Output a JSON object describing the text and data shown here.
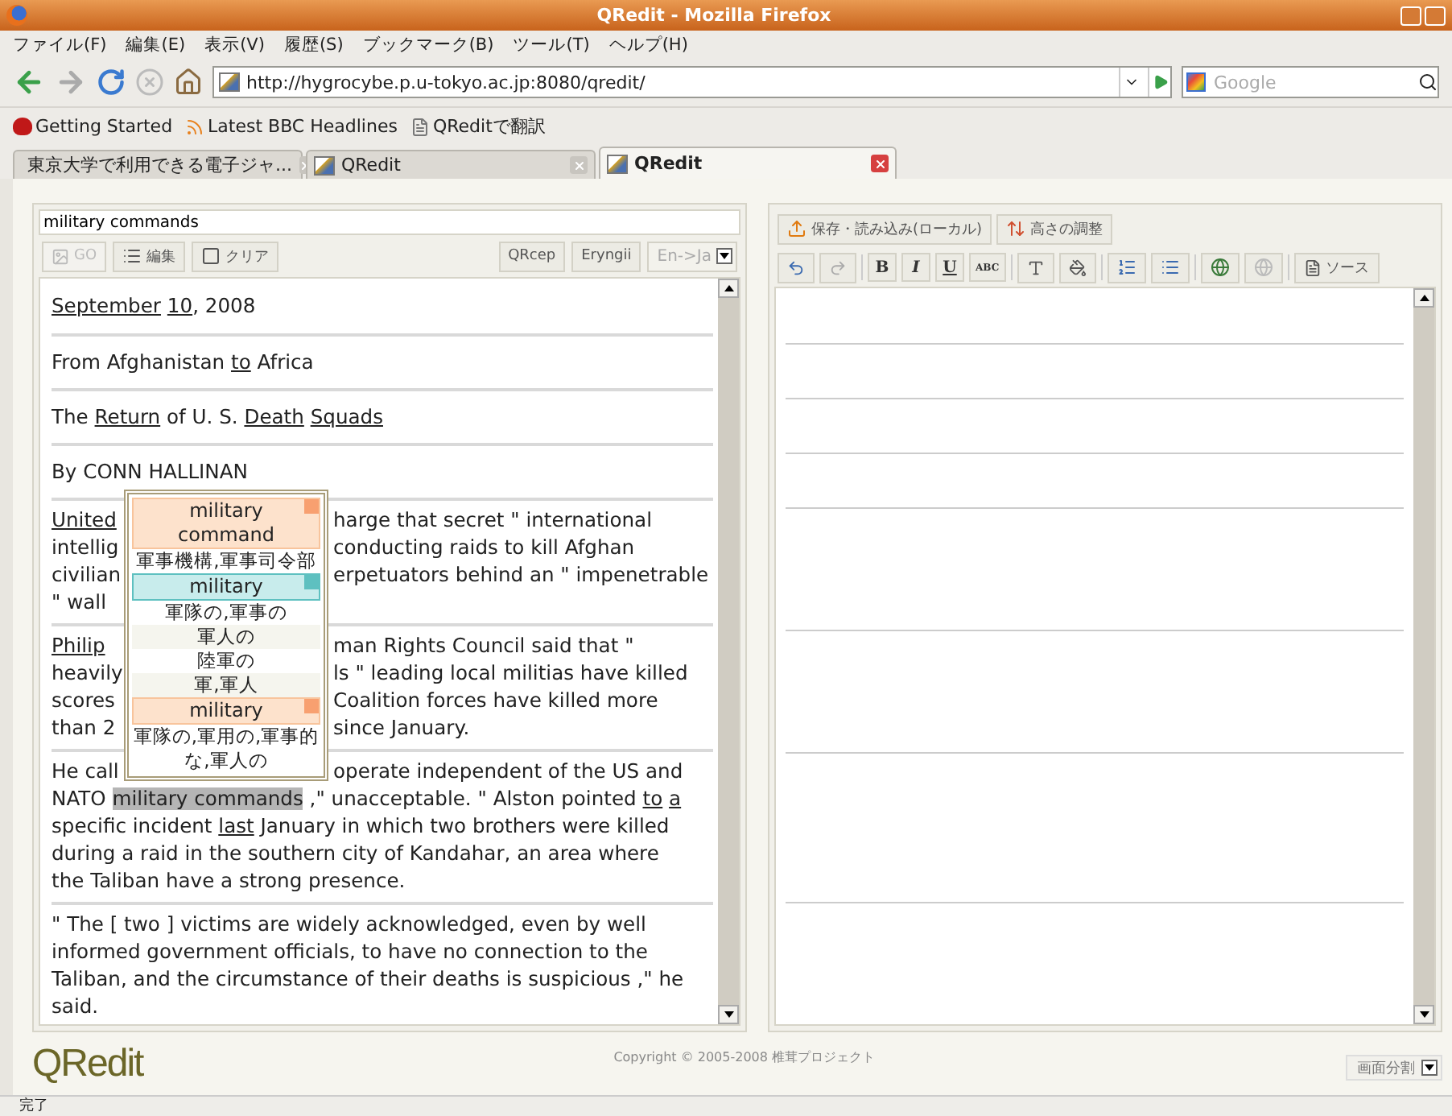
{
  "window": {
    "title": "QRedit - Mozilla Firefox"
  },
  "menu": [
    "ファイル(F)",
    "編集(E)",
    "表示(V)",
    "履歴(S)",
    "ブックマーク(B)",
    "ツール(T)",
    "ヘルプ(H)"
  ],
  "address": {
    "url": "http://hygrocybe.p.u-tokyo.ac.jp:8080/qredit/"
  },
  "web_search": {
    "placeholder": "Google"
  },
  "bookmarks": [
    {
      "kind": "start",
      "label": "Getting Started"
    },
    {
      "kind": "feed",
      "label": "Latest BBC Headlines"
    },
    {
      "kind": "page",
      "label": "QReditで翻訳"
    }
  ],
  "tabs": [
    {
      "kind": "page",
      "label": "東京大学で利用できる電子ジャ...",
      "selected": false
    },
    {
      "kind": "app",
      "label": "QRedit",
      "selected": false
    },
    {
      "kind": "app",
      "label": "QRedit",
      "selected": true
    }
  ],
  "query": {
    "value": "military commands"
  },
  "left_toolbar": {
    "buttons": [
      {
        "kind": "go",
        "label": "GO",
        "disabled": true
      },
      {
        "kind": "edit",
        "label": "編集",
        "disabled": false
      },
      {
        "kind": "clear",
        "label": "クリア",
        "disabled": false
      }
    ],
    "dictionaries": [
      "QRcep",
      "Eryngii"
    ],
    "direction": "En->Ja"
  },
  "paragraphs": [
    {
      "lines": [
        {
          "left": [
            {
              "kind": "link",
              "text": "September "
            },
            {
              "kind": "link",
              "text": "10"
            },
            {
              "kind": "plain",
              "text": ", 2008"
            }
          ]
        }
      ]
    },
    {
      "lines": [
        {
          "left": [
            {
              "kind": "plain",
              "text": "From Afghanistan "
            },
            {
              "kind": "link",
              "text": "to"
            },
            {
              "kind": "plain",
              "text": " Africa"
            }
          ]
        }
      ]
    },
    {
      "lines": [
        {
          "left": [
            {
              "kind": "plain",
              "text": "The "
            },
            {
              "kind": "link",
              "text": "Return"
            },
            {
              "kind": "plain",
              "text": " of U. S. "
            },
            {
              "kind": "link",
              "text": "Death "
            },
            {
              "kind": "link",
              "text": "Squads"
            }
          ]
        }
      ]
    },
    {
      "lines": [
        {
          "left": [
            {
              "kind": "plain",
              "text": "By CONN HALLINAN"
            }
          ]
        }
      ]
    },
    {
      "lines": [
        {
          "left": [
            {
              "kind": "link",
              "text": "United"
            }
          ],
          "right": [
            {
              "kind": "plain",
              "text": "harge that secret \" international"
            }
          ]
        },
        {
          "left": [
            {
              "kind": "plain",
              "text": "intellig"
            }
          ],
          "right": [
            {
              "kind": "plain",
              "text": "conducting raids to kill Afghan"
            }
          ]
        },
        {
          "left": [
            {
              "kind": "plain",
              "text": "civilian"
            }
          ],
          "right": [
            {
              "kind": "plain",
              "text": "erpetuators behind an \" impenetrable"
            }
          ]
        },
        {
          "left": [
            {
              "kind": "plain",
              "text": "\" wall"
            }
          ]
        }
      ]
    },
    {
      "lines": [
        {
          "left": [
            {
              "kind": "link",
              "text": "Philip"
            }
          ],
          "right": [
            {
              "kind": "plain",
              "text": "man Rights Council said that \""
            }
          ]
        },
        {
          "left": [
            {
              "kind": "plain",
              "text": "heavily"
            }
          ],
          "right": [
            {
              "kind": "plain",
              "text": "ls \" leading local militias have killed"
            }
          ]
        },
        {
          "left": [
            {
              "kind": "plain",
              "text": "scores"
            }
          ],
          "right": [
            {
              "kind": "plain",
              "text": "Coalition forces have killed more"
            }
          ]
        },
        {
          "left": [
            {
              "kind": "plain",
              "text": "than 2"
            }
          ],
          "right": [
            {
              "kind": "plain",
              "text": "since January."
            }
          ]
        }
      ]
    },
    {
      "lines": [
        {
          "left": [
            {
              "kind": "plain",
              "text": "He call"
            }
          ],
          "right": [
            {
              "kind": "plain",
              "text": "operate independent of the US and"
            }
          ]
        },
        {
          "left": [
            {
              "kind": "plain",
              "text": "NATO "
            },
            {
              "kind": "highlight",
              "text": "military commands"
            },
            {
              "kind": "plain",
              "text": " ,\" unacceptable. \" Alston pointed "
            },
            {
              "kind": "link",
              "text": "to "
            },
            {
              "kind": "link",
              "text": "a"
            }
          ]
        },
        {
          "left": [
            {
              "kind": "plain",
              "text": "specific incident "
            },
            {
              "kind": "link",
              "text": "last"
            },
            {
              "kind": "plain",
              "text": " January in which two brothers were killed"
            }
          ]
        },
        {
          "left": [
            {
              "kind": "plain",
              "text": "during a raid in the southern city of Kandahar, an area where"
            }
          ]
        },
        {
          "left": [
            {
              "kind": "plain",
              "text": "the Taliban have a strong presence."
            }
          ]
        }
      ]
    },
    {
      "lines": [
        {
          "left": [
            {
              "kind": "plain",
              "text": "\" The [ two ] victims are widely acknowledged, even by well"
            }
          ]
        },
        {
          "left": [
            {
              "kind": "plain",
              "text": "informed government officials, to have no connection to the"
            }
          ]
        },
        {
          "left": [
            {
              "kind": "plain",
              "text": "Taliban, and the circumstance of their deaths is suspicious ,\" he"
            }
          ]
        },
        {
          "left": [
            {
              "kind": "plain",
              "text": "said."
            }
          ]
        }
      ]
    }
  ],
  "popup": [
    {
      "kind": "headword",
      "text": "military command",
      "selected": false
    },
    {
      "kind": "meaning",
      "text": "軍事機構,軍事司令部"
    },
    {
      "kind": "headword",
      "text": "military",
      "selected": true
    },
    {
      "kind": "meaning",
      "text": "軍隊の,軍事の"
    },
    {
      "kind": "meaning",
      "text": "軍人の"
    },
    {
      "kind": "meaning",
      "text": "陸軍の"
    },
    {
      "kind": "meaning",
      "text": "軍,軍人"
    },
    {
      "kind": "headword",
      "text": "military",
      "selected": false
    },
    {
      "kind": "meaning",
      "text": "軍隊の,軍用の,軍事的な,軍人の"
    }
  ],
  "right_toolbar": {
    "buttons": [
      "保存・読み込み(ローカル)",
      "高さの調整"
    ],
    "format_buttons": [
      "B",
      "I",
      "U",
      "ABC"
    ],
    "source": "ソース"
  },
  "footer": {
    "logo": "QRedit",
    "copyright": "Copyright © 2005-2008 椎茸プロジェクト",
    "layout_select": "画面分割"
  },
  "status_bar": "完了"
}
